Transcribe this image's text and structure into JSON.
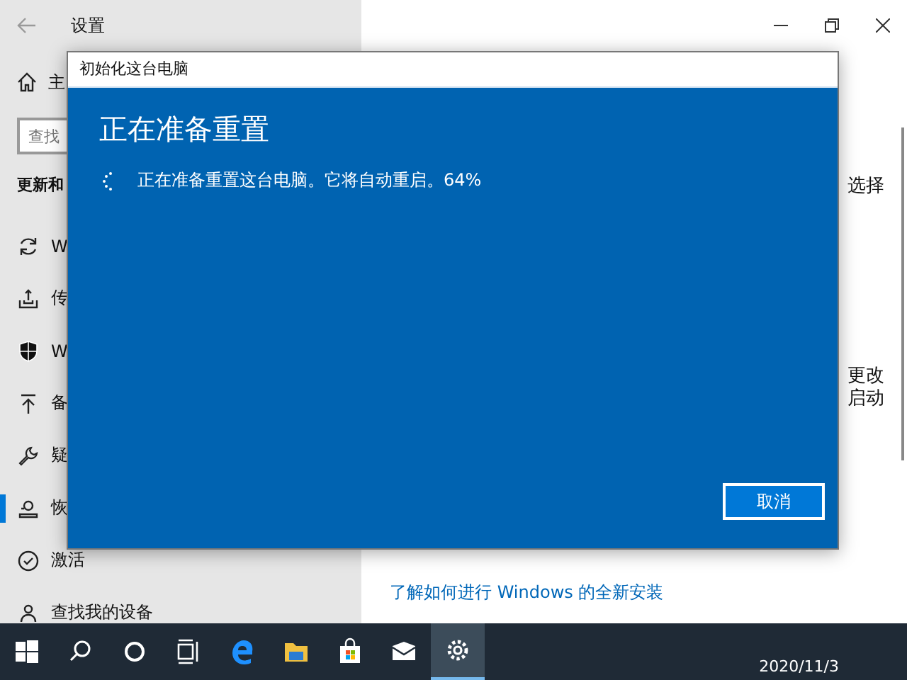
{
  "settings_window": {
    "title": "设置",
    "sidebar": {
      "home_label": "主",
      "search": {
        "placeholder": "查找"
      },
      "section_title": "更新和",
      "items": [
        {
          "kind": "sync",
          "label": "W",
          "selected": false
        },
        {
          "kind": "tray",
          "label": "传",
          "selected": false
        },
        {
          "kind": "shield",
          "label": "W",
          "selected": false
        },
        {
          "kind": "upload",
          "label": "备",
          "selected": false
        },
        {
          "kind": "wrench",
          "label": "疑",
          "selected": false
        },
        {
          "kind": "recovery",
          "label": "恢",
          "selected": true
        },
        {
          "kind": "check",
          "label": "激活",
          "selected": false
        },
        {
          "kind": "person",
          "label": "查找我的设备",
          "selected": false
        }
      ]
    },
    "content": {
      "text_1": "选择",
      "text_2": [
        "更改",
        "启动"
      ],
      "link": "了解如何进行 Windows 的全新安装"
    }
  },
  "dialog": {
    "title": "初始化这台电脑",
    "heading": "正在准备重置",
    "message": "正在准备重置这台电脑。它将自动重启。64%",
    "button": "取消"
  },
  "taskbar": {
    "items": [
      {
        "kind": "start",
        "selected": false
      },
      {
        "kind": "search",
        "selected": false
      },
      {
        "kind": "cortana",
        "selected": false
      },
      {
        "kind": "taskview",
        "selected": false
      },
      {
        "kind": "edge",
        "selected": false
      },
      {
        "kind": "explorer",
        "selected": false
      },
      {
        "kind": "store",
        "selected": false
      },
      {
        "kind": "mail",
        "selected": false
      },
      {
        "kind": "settings",
        "selected": true
      }
    ],
    "clock": "2020/11/3"
  }
}
